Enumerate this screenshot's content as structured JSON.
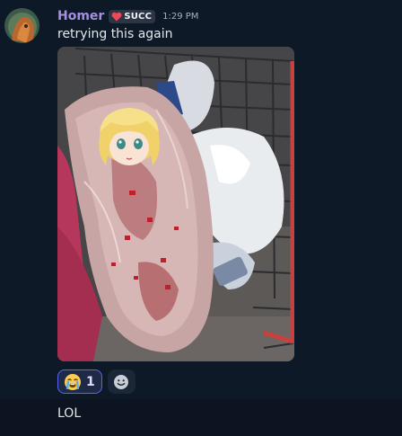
{
  "message": {
    "username": "Homer",
    "role_tag": "SUCC",
    "timestamp": "1:29 PM",
    "text": "retrying this again",
    "attachment": {
      "type": "image"
    },
    "reactions": [
      {
        "emoji": "😭",
        "icon": "loudly-crying-face-icon",
        "count": "1"
      }
    ],
    "add_reaction_icon": "smiley-add-reaction-icon"
  },
  "next_message": {
    "text": "LOL"
  },
  "colors": {
    "background": "#0c1624",
    "username": "#a391e0",
    "reaction_border": "#5865f2",
    "reaction_bg": "#1f2a47"
  }
}
